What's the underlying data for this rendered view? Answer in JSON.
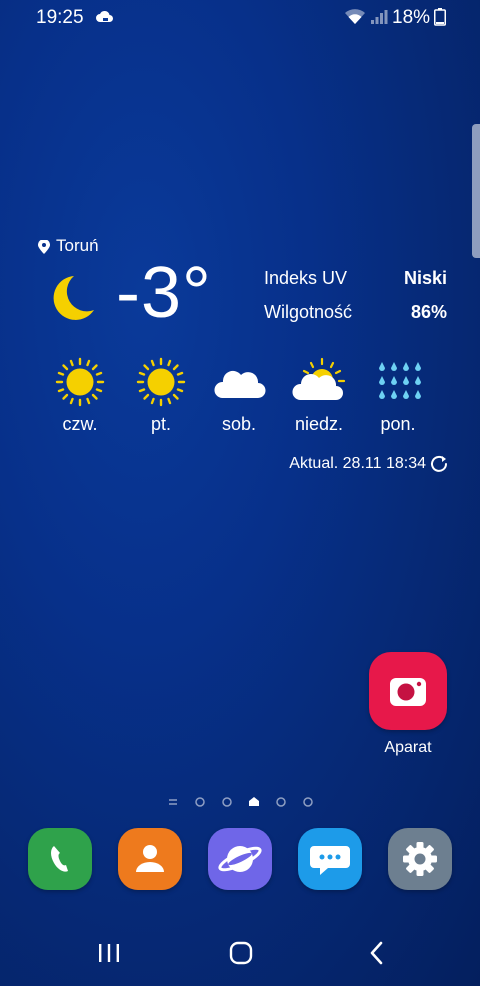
{
  "status_bar": {
    "time": "19:25",
    "battery": "18%",
    "icons": [
      "cloud-sync-icon",
      "wifi-icon",
      "signal-icon",
      "battery-icon"
    ]
  },
  "weather": {
    "location": "Toruń",
    "temperature": "-3°",
    "current_condition_icon": "moon-icon",
    "uv_label": "Indeks UV",
    "uv_value": "Niski",
    "humidity_label": "Wilgotność",
    "humidity_value": "86%",
    "forecast": [
      {
        "day": "czw.",
        "icon": "sun-icon"
      },
      {
        "day": "pt.",
        "icon": "sun-icon"
      },
      {
        "day": "sob.",
        "icon": "cloud-icon"
      },
      {
        "day": "niedz.",
        "icon": "partly-cloudy-icon"
      },
      {
        "day": "pon.",
        "icon": "rain-icon"
      }
    ],
    "updated": "Aktual. 28.11 18:34"
  },
  "home_apps": [
    {
      "label": "Aparat",
      "icon": "camera-icon"
    }
  ],
  "page_indicator": {
    "pages": 6,
    "current": 3
  },
  "dock": [
    {
      "name": "phone",
      "icon": "phone-icon",
      "color": "#2fa24b"
    },
    {
      "name": "contacts",
      "icon": "contacts-icon",
      "color": "#ee7a1d"
    },
    {
      "name": "internet",
      "icon": "planet-icon",
      "color": "#6f66e8"
    },
    {
      "name": "messages",
      "icon": "chat-bubble-icon",
      "color": "#1d9be9"
    },
    {
      "name": "settings",
      "icon": "gear-icon",
      "color": "#6d7f90"
    }
  ],
  "nav_bar": [
    "recents-icon",
    "home-icon",
    "back-icon"
  ]
}
